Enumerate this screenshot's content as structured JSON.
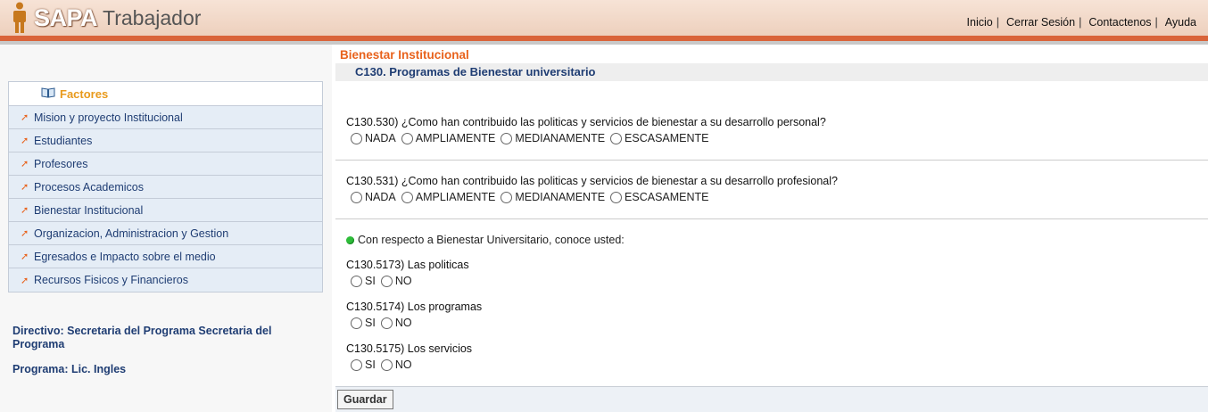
{
  "app": {
    "brand": "SAPA",
    "subtitle": "Trabajador"
  },
  "topnav": {
    "items": [
      "Inicio",
      "Cerrar Sesión",
      "Contactenos",
      "Ayuda"
    ],
    "separator": "|"
  },
  "sidebar": {
    "title": "Factores",
    "items": [
      "Mision y proyecto Institucional",
      "Estudiantes",
      "Profesores",
      "Procesos Academicos",
      "Bienestar Institucional",
      "Organizacion, Administracion y Gestion",
      "Egresados e Impacto sobre el medio",
      "Recursos Fisicos y Financieros"
    ],
    "directivo": "Directivo: Secretaria del Programa Secretaria del Programa",
    "programa": "Programa: Lic. Ingles"
  },
  "main": {
    "section_title": "Bienestar Institucional",
    "subsection_title": "C130. Programas de Bienestar universitario",
    "questions": [
      {
        "text": "C130.530) ¿Como han contribuido las politicas y servicios de bienestar a su desarrollo personal?",
        "options": [
          "NADA",
          "AMPLIAMENTE",
          "MEDIANAMENTE",
          "ESCASAMENTE"
        ]
      },
      {
        "text": "C130.531) ¿Como han contribuido las politicas y servicios de bienestar a su desarrollo profesional?",
        "options": [
          "NADA",
          "AMPLIAMENTE",
          "MEDIANAMENTE",
          "ESCASAMENTE"
        ]
      }
    ],
    "group_title": "Con respecto a Bienestar Universitario, conoce usted:",
    "sub_questions": [
      {
        "text": "C130.5173) Las politicas",
        "options": [
          "SI",
          "NO"
        ]
      },
      {
        "text": "C130.5174) Los programas",
        "options": [
          "SI",
          "NO"
        ]
      },
      {
        "text": "C130.5175) Los servicios",
        "options": [
          "SI",
          "NO"
        ]
      }
    ],
    "save_label": "Guardar"
  },
  "colors": {
    "accent": "#e8621c",
    "nav_text": "#1f3d73",
    "header_bar": "#d9643a",
    "status_dot": "#2ebd3a"
  },
  "icons": {
    "logo": "person-icon",
    "factors": "book-icon",
    "item": "arrow-icon",
    "group": "green-dot-icon"
  }
}
